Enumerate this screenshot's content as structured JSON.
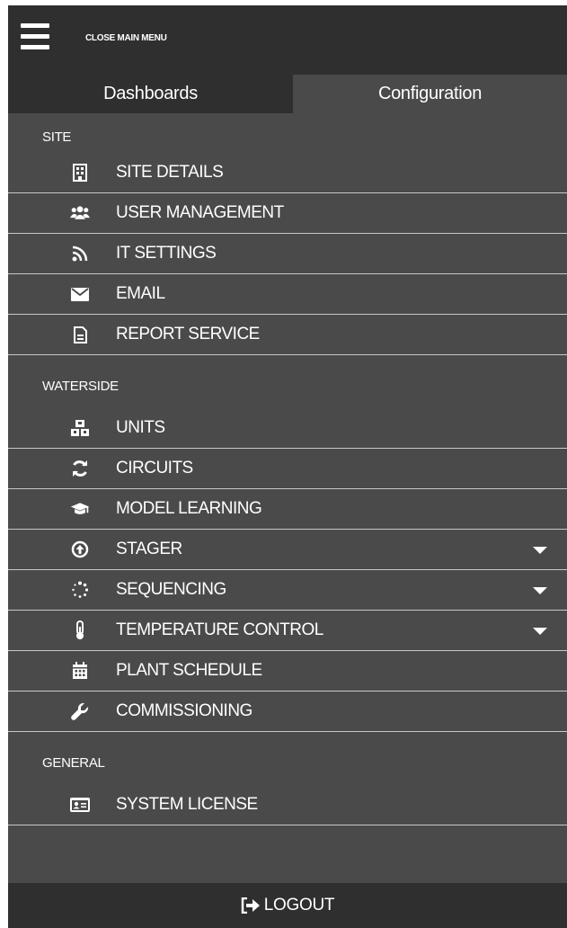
{
  "header": {
    "close_menu_label": "CLOSE MAIN MENU"
  },
  "tabs": [
    {
      "label": "Dashboards",
      "active": false
    },
    {
      "label": "Configuration",
      "active": true
    }
  ],
  "sections": [
    {
      "title": "SITE",
      "items": [
        {
          "label": "SITE DETAILS",
          "icon": "building-icon"
        },
        {
          "label": "USER MANAGEMENT",
          "icon": "users-icon"
        },
        {
          "label": "IT SETTINGS",
          "icon": "rss-icon"
        },
        {
          "label": "EMAIL",
          "icon": "envelope-icon"
        },
        {
          "label": "REPORT SERVICE",
          "icon": "document-icon"
        }
      ]
    },
    {
      "title": "WATERSIDE",
      "items": [
        {
          "label": "UNITS",
          "icon": "cubes-icon"
        },
        {
          "label": "CIRCUITS",
          "icon": "refresh-icon"
        },
        {
          "label": "MODEL LEARNING",
          "icon": "graduation-cap-icon"
        },
        {
          "label": "STAGER",
          "icon": "arrow-circle-up-icon",
          "expandable": true
        },
        {
          "label": "SEQUENCING",
          "icon": "spinner-icon",
          "expandable": true
        },
        {
          "label": "TEMPERATURE CONTROL",
          "icon": "thermometer-icon",
          "expandable": true
        },
        {
          "label": "PLANT SCHEDULE",
          "icon": "calendar-icon"
        },
        {
          "label": "COMMISSIONING",
          "icon": "wrench-icon"
        }
      ]
    },
    {
      "title": "GENERAL",
      "items": [
        {
          "label": "SYSTEM LICENSE",
          "icon": "id-card-icon"
        }
      ]
    }
  ],
  "footer": {
    "logout_label": "LOGOUT",
    "logout_icon": "sign-out-icon"
  },
  "colors": {
    "panel": "#4a4a4a",
    "bar": "#2f2f2f",
    "divider": "#c8c8c8",
    "text": "#ffffff"
  }
}
